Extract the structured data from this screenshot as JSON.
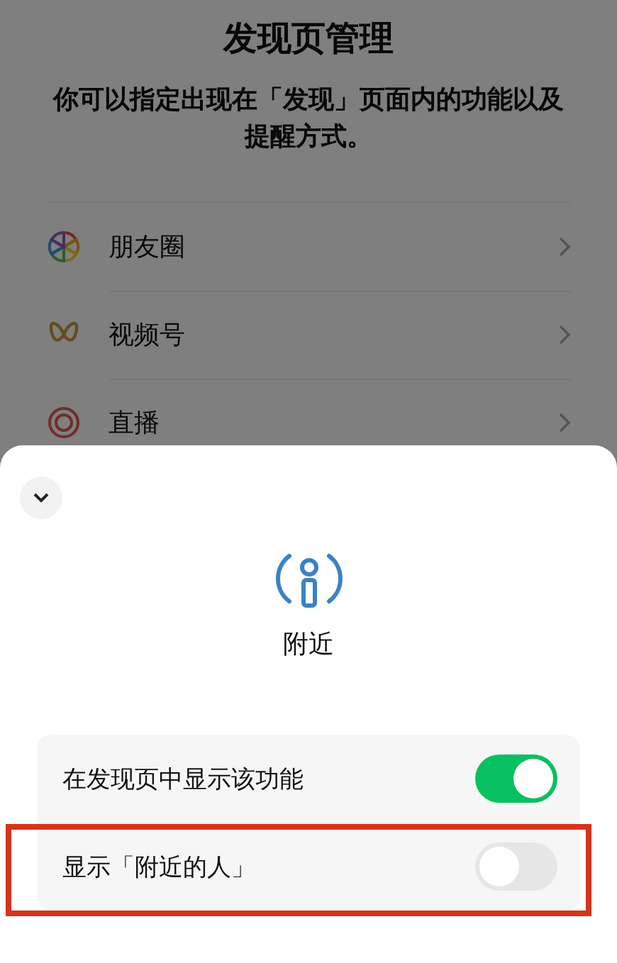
{
  "page": {
    "title": "发现页管理",
    "description": "你可以指定出现在「发现」页面内的功能以及提醒方式。",
    "items": [
      {
        "label": "朋友圈",
        "kind": "moments"
      },
      {
        "label": "视频号",
        "kind": "channels"
      },
      {
        "label": "直播",
        "kind": "live"
      }
    ]
  },
  "sheet": {
    "title": "附近",
    "settings": [
      {
        "label": "在发现页中显示该功能",
        "on": true,
        "highlighted": false
      },
      {
        "label": "显示「附近的人」",
        "on": false,
        "highlighted": true
      }
    ]
  }
}
